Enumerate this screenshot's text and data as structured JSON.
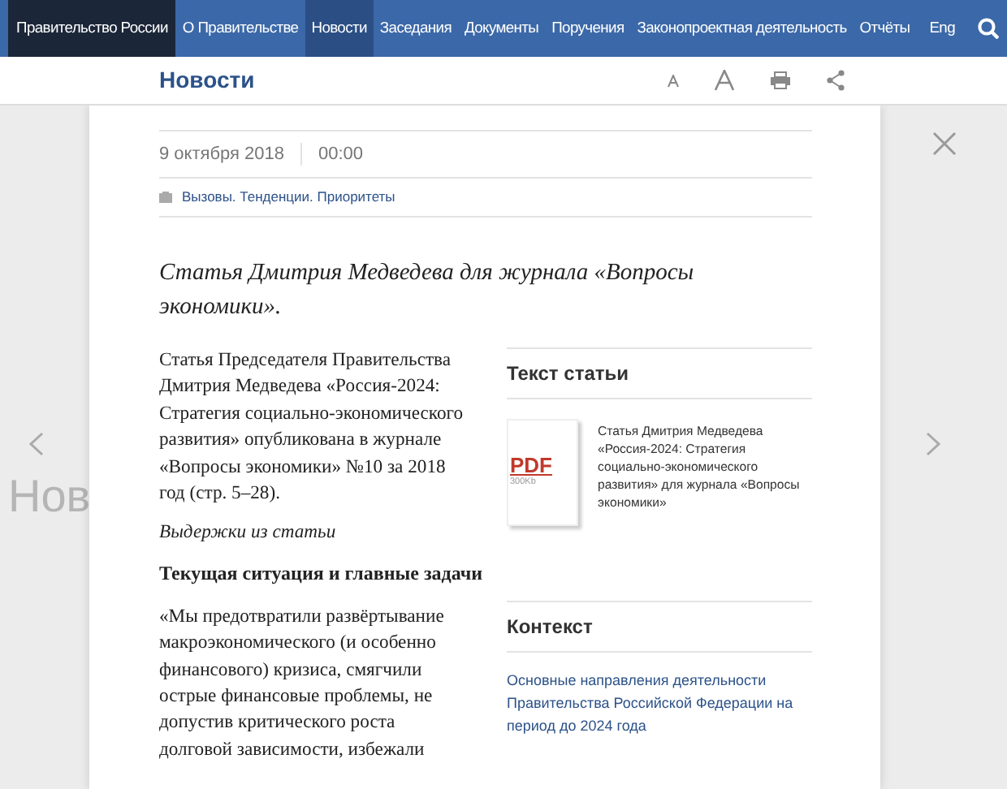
{
  "nav": {
    "brand": "Правительство России",
    "items": [
      {
        "label": "О Правительстве",
        "selected": false
      },
      {
        "label": "Новости",
        "selected": true
      },
      {
        "label": "Заседания",
        "selected": false
      },
      {
        "label": "Документы",
        "selected": false
      },
      {
        "label": "Поручения",
        "selected": false
      },
      {
        "label": "Законопроектная деятельность",
        "selected": false
      },
      {
        "label": "Отчёты",
        "selected": false
      }
    ],
    "language": "Eng"
  },
  "background": {
    "title_fragment": "Нов"
  },
  "header": {
    "title": "Новости"
  },
  "article": {
    "date": "9 октября 2018",
    "time": "00:00",
    "tags": "Вызовы. Тенденции. Приоритеты",
    "lead": "Статья Дмитрия Медведева для журнала «Вопросы экономики».",
    "paragraphs": [
      {
        "kind": "text",
        "text": "Статья Председателя Правительства Дмитрия Медведева «Россия-2024: Стратегия социально-экономического развития» опубликована в журнале «Вопросы экономики» №10 за 2018 год (стр. 5–28)."
      },
      {
        "kind": "italic",
        "text": "Выдержки из статьи"
      },
      {
        "kind": "heading",
        "text": "Текущая ситуация и главные задачи"
      },
      {
        "kind": "text",
        "text": "«Мы предотвратили развёртывание макроэкономического (и особенно финансового) кризиса, смягчили острые финансовые проблемы, не допустив критического роста долговой зависимости, избежали"
      }
    ]
  },
  "sidebar": {
    "document": {
      "heading": "Текст статьи",
      "file_type": "PDF",
      "size": "300Kb",
      "title": "Статья Дмитрия Медведева «Россия-2024: Стратегия социально-экономического развития» для журнала «Вопросы экономики»"
    },
    "context": {
      "heading": "Контекст",
      "links": [
        "Основные направления деятельности Правительства Российской Федерации на период до 2024 года"
      ]
    }
  }
}
